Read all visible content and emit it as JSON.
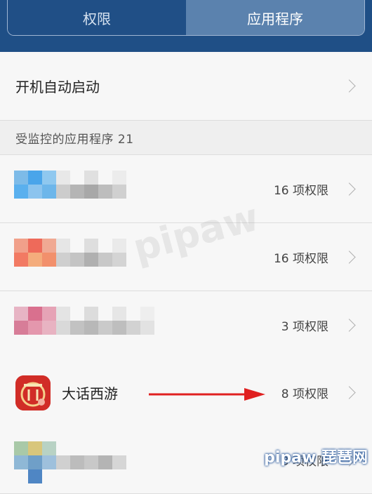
{
  "tabs": {
    "permissions": "权限",
    "apps": "应用程序"
  },
  "autostart": {
    "label": "开机自动启动"
  },
  "section": {
    "label": "受监控的应用程序 21"
  },
  "apps": [
    {
      "name": "",
      "permissions": "16 项权限"
    },
    {
      "name": "",
      "permissions": "16 项权限"
    },
    {
      "name": "",
      "permissions": "3 项权限"
    },
    {
      "name": "大话西游",
      "permissions": "8 项权限"
    },
    {
      "name": "",
      "permissions": "3 项权限"
    }
  ],
  "watermarks": {
    "center": "pipaw",
    "corner": "pipaw 琵琶网"
  },
  "colors": {
    "header": "#1f4f86",
    "active_tab": "#5b82ae",
    "arrow": "#e02020"
  }
}
